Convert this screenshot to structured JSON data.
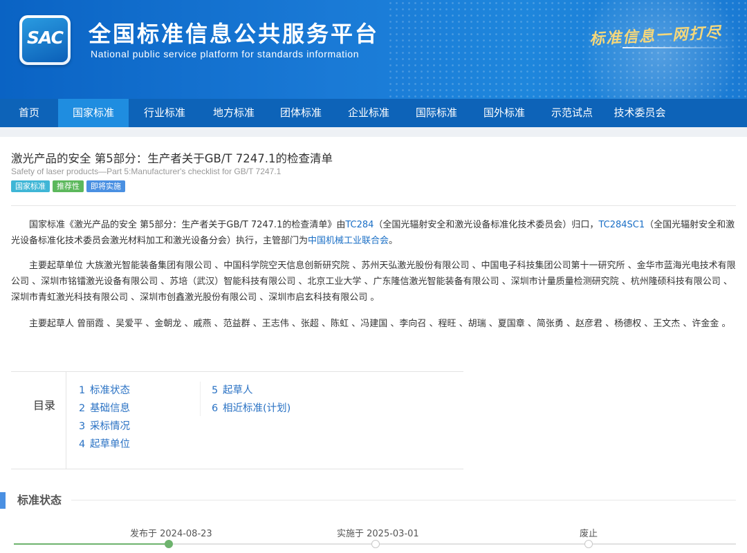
{
  "banner": {
    "logo_text": "SAC",
    "title": "全国标准信息公共服务平台",
    "subtitle": "National public service platform  for standards information",
    "slogan": "标准信息一网打尽",
    "colors": {
      "banner": "#1a7ad6",
      "slogan": "#f4d77b"
    }
  },
  "nav": {
    "items": [
      "首页",
      "国家标准",
      "行业标准",
      "地方标准",
      "团体标准",
      "企业标准",
      "国际标准",
      "国外标准",
      "示范试点",
      "技术委员会"
    ],
    "active_index": 1,
    "colors": {
      "background": "#0d63b8",
      "active": "#1f8de0"
    }
  },
  "document": {
    "title": "激光产品的安全 第5部分：生产者关于GB/T 7247.1的检查清单",
    "title_en": "Safety of laser products—Part 5:Manufacturer's checklist for GB/T 7247.1",
    "tags": [
      "国家标准",
      "推荐性",
      "即将实施"
    ],
    "intro": {
      "t1": "国家标准《激光产品的安全 第5部分：生产者关于GB/T 7247.1的检查清单》由",
      "link1": "TC284",
      "t2": "（全国光辐射安全和激光设备标准化技术委员会）归口，",
      "link2": "TC284SC1",
      "t3": "（全国光辐射安全和激光设备标准化技术委员会激光材料加工和激光设备分会）执行，主管部门为",
      "link3": "中国机械工业联合会",
      "t4": "。"
    },
    "drafting_units": "主要起草单位 大族激光智能装备集团有限公司 、中国科学院空天信息创新研究院 、苏州天弘激光股份有限公司 、中国电子科技集团公司第十一研究所 、金华市蓝海光电技术有限公司 、深圳市铭镭激光设备有限公司 、苏培（武汉）智能科技有限公司 、北京工业大学 、广东隆信激光智能装备有限公司 、深圳市计量质量检测研究院 、杭州隆硕科技有限公司 、深圳市青虹激光科技有限公司 、深圳市创鑫激光股份有限公司 、深圳市启玄科技有限公司 。",
    "drafters": "主要起草人 曾丽霞 、吴爱平 、金朝龙 、戚燕 、范益群 、王志伟 、张超 、陈虹 、冯建国 、李向召 、程旺 、胡瑞 、夏国章 、简张勇 、赵彦君 、杨德权 、王文杰 、许金金 。"
  },
  "toc": {
    "heading": "目录",
    "items": [
      {
        "num": "1",
        "label": "标准状态"
      },
      {
        "num": "2",
        "label": "基础信息"
      },
      {
        "num": "3",
        "label": "采标情况"
      },
      {
        "num": "4",
        "label": "起草单位"
      },
      {
        "num": "5",
        "label": "起草人"
      },
      {
        "num": "6",
        "label": "相近标准(计划)"
      }
    ]
  },
  "status_section": {
    "title": "标准状态",
    "timeline": [
      {
        "label": "发布于 2024-08-23",
        "done": true
      },
      {
        "label": "实施于 2025-03-01",
        "done": false
      },
      {
        "label": "废止",
        "done": false
      }
    ],
    "colors": {
      "done": "#6db36d",
      "pending": "#c8c8c8"
    }
  }
}
